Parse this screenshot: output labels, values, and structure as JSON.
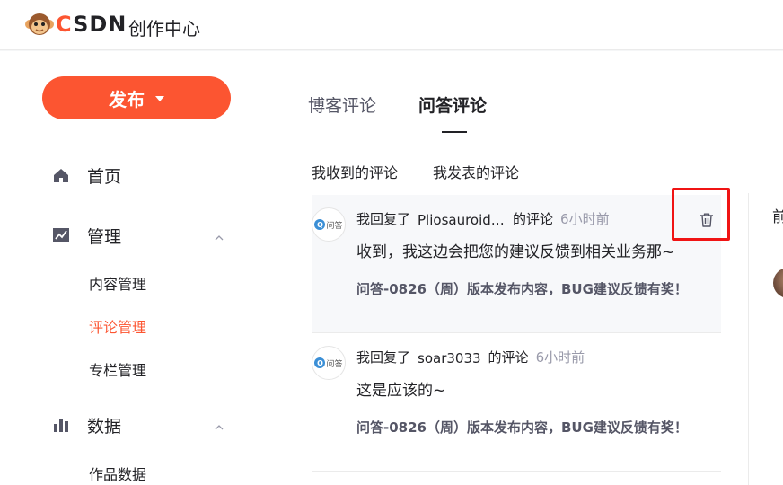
{
  "header": {
    "logo_text_first": "C",
    "logo_text_rest": "SDN",
    "product_title": "创作中心"
  },
  "sidebar": {
    "publish_label": "发布",
    "items": [
      {
        "label": "首页",
        "icon": "home-icon"
      },
      {
        "label": "管理",
        "icon": "chart-line-icon",
        "children": [
          "内容管理",
          "评论管理",
          "专栏管理"
        ],
        "active_child": "评论管理"
      },
      {
        "label": "数据",
        "icon": "bar-chart-icon",
        "children": [
          "作品数据"
        ]
      }
    ]
  },
  "main": {
    "tabs": [
      {
        "label": "博客评论",
        "active": false
      },
      {
        "label": "问答评论",
        "active": true
      }
    ],
    "subtabs": [
      {
        "label": "我收到的评论",
        "active": false
      },
      {
        "label": "我发表的评论",
        "active": true
      }
    ],
    "comments": [
      {
        "prefix": "我回复了",
        "name": "Pliosauroidea",
        "suffix": "的评论",
        "time": "6小时前",
        "text": "收到，我这边会把您的建议反馈到相关业务那~",
        "article_title": "问答-0826（周）版本发布内容，BUG建议反馈有奖！",
        "avatar_text": "问答"
      },
      {
        "prefix": "我回复了",
        "name": "soar3033",
        "suffix": "的评论",
        "time": "6小时前",
        "text": "这是应该的~",
        "article_title": "问答-0826（周）版本发布内容，BUG建议反馈有奖！",
        "avatar_text": "问答"
      }
    ]
  },
  "right_panel": {
    "peek_text": "前"
  },
  "colors": {
    "brand": "#fc5531",
    "highlight_box": "#f01414",
    "text_primary": "#222226",
    "text_secondary": "#555666",
    "text_muted": "#999aaa"
  }
}
